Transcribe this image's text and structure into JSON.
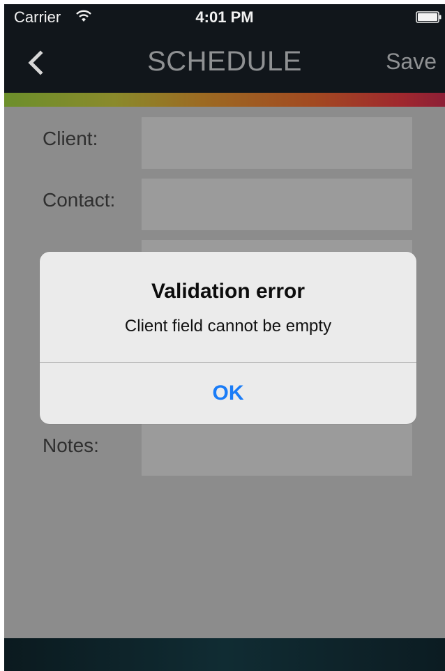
{
  "status_bar": {
    "carrier": "Carrier",
    "time": "4:01 PM"
  },
  "nav": {
    "title": "SCHEDULE",
    "save_label": "Save"
  },
  "form": {
    "fields": [
      {
        "label": "Client:",
        "value": ""
      },
      {
        "label": "Contact:",
        "value": ""
      },
      {
        "label": "",
        "value": ""
      },
      {
        "label": "Notes:",
        "value": ""
      }
    ]
  },
  "alert": {
    "title": "Validation error",
    "message": "Client field cannot be empty",
    "button_label": "OK"
  },
  "icons": [
    "wifi-icon",
    "battery-icon",
    "back-chevron-icon"
  ],
  "colors": {
    "accent_blue": "#1a7cf7",
    "nav_bg": "#11161b",
    "overlay_gray": "#8c8c8c"
  }
}
